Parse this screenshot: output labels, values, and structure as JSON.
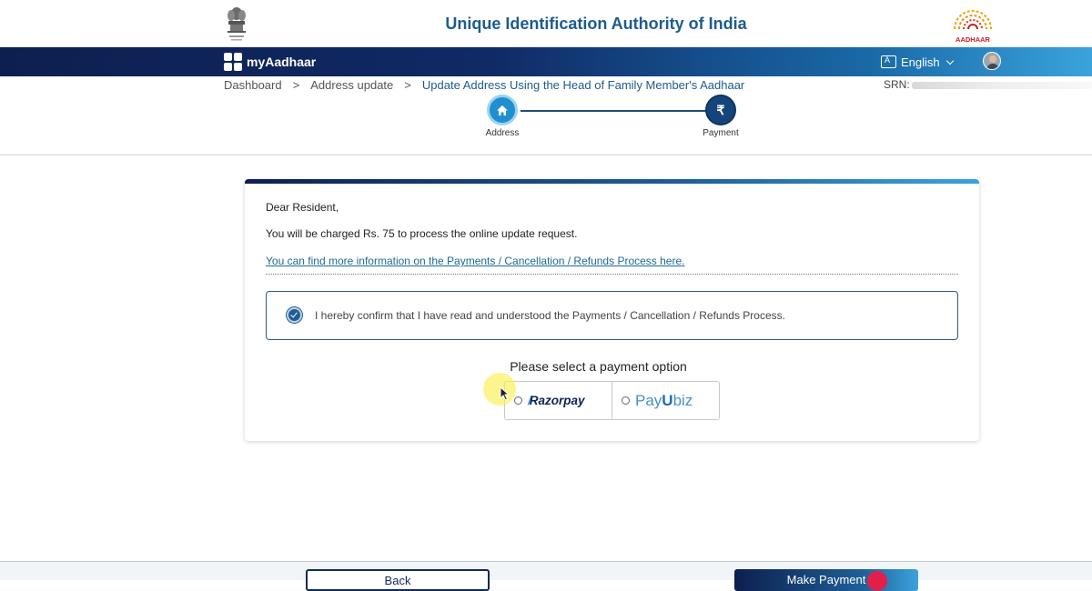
{
  "header": {
    "org_title": "Unique Identification Authority of India",
    "aadhaar_logo_text": "AADHAAR"
  },
  "navbar": {
    "brand": "myAadhaar",
    "language": "English"
  },
  "breadcrumb": {
    "items": [
      "Dashboard",
      "Address update",
      "Update Address Using the Head of Family Member's Aadhaar"
    ],
    "separator": ">",
    "srn_label": "SRN:"
  },
  "stepper": {
    "steps": [
      {
        "label": "Address",
        "icon": "home-icon"
      },
      {
        "label": "Payment",
        "icon": "rupee-icon",
        "symbol": "₹"
      }
    ]
  },
  "card": {
    "greeting": "Dear Resident,",
    "charge_text": "You will be charged Rs. 75 to process the online update request.",
    "info_link": "You can find more information on the Payments / Cancellation / Refunds Process here.",
    "confirm_text": "I hereby confirm that I have read and understood the Payments / Cancellation / Refunds Process.",
    "confirm_checked": true,
    "payment_title": "Please select a payment option",
    "payment_options": [
      {
        "name": "Razorpay",
        "selected": false
      },
      {
        "name_a": "Pay",
        "name_b": "U",
        "name_c": "biz",
        "selected": false
      }
    ]
  },
  "footer": {
    "back_label": "Back",
    "pay_label": "Make Payment"
  },
  "colors": {
    "primary": "#1d5c8c",
    "nav_dark": "#0d1f4f",
    "nav_light": "#3aa3dc",
    "link": "#1d6a96"
  }
}
